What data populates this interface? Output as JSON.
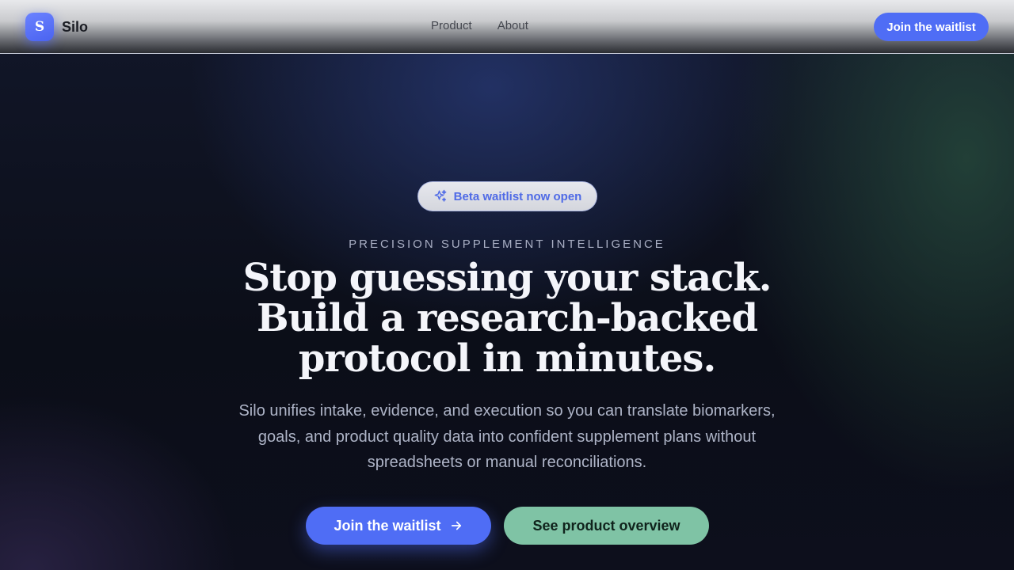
{
  "header": {
    "brand": {
      "logo_letter": "S",
      "name": "Silo"
    },
    "nav": [
      {
        "label": "Product"
      },
      {
        "label": "About"
      }
    ],
    "cta_label": "Join the waitlist"
  },
  "hero": {
    "badge": {
      "icon": "sparkles-icon",
      "label": "Beta waitlist now open"
    },
    "eyebrow": "PRECISION SUPPLEMENT INTELLIGENCE",
    "headline": "Stop guessing your stack. Build a research-backed protocol in minutes.",
    "subtitle": "Silo unifies intake, evidence, and execution so you can translate biomarkers, goals, and product quality data into confident supplement plans without spreadsheets or manual reconciliations.",
    "primary_cta": {
      "label": "Join the waitlist",
      "icon": "arrow-right-icon"
    },
    "secondary_cta": {
      "label": "See product overview"
    }
  },
  "colors": {
    "accent": "#4f6df5",
    "secondary": "#7fc3a5",
    "background": "#0b0e17"
  }
}
